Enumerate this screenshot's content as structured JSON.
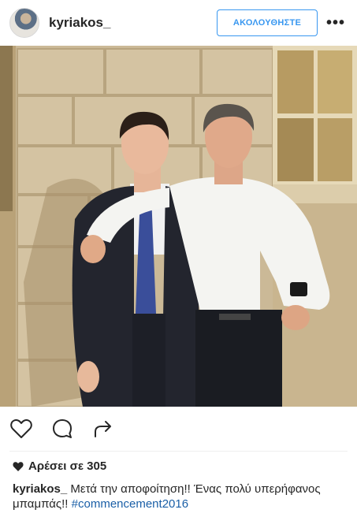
{
  "header": {
    "username": "kyriakos_",
    "follow_label": "ΑΚΟΛΟΥΘΗΣΤΕ",
    "more_label": "•••",
    "avatar_icon": "profile-avatar"
  },
  "actions": {
    "like_icon": "heart-outline-icon",
    "comment_icon": "comment-bubble-icon",
    "share_icon": "share-arrow-icon"
  },
  "likes": {
    "icon": "heart-filled-icon",
    "text": "Αρέσει σε 305"
  },
  "caption": {
    "username": "kyriakos_",
    "text": "Μετά την αποφοίτηση!! Ένας πολύ υπερήφανος μπαμπάς!!",
    "hashtag": "#commencement2016"
  },
  "colors": {
    "accent": "#3897f0",
    "hashtag": "#1a5fa7",
    "text": "#262626"
  }
}
